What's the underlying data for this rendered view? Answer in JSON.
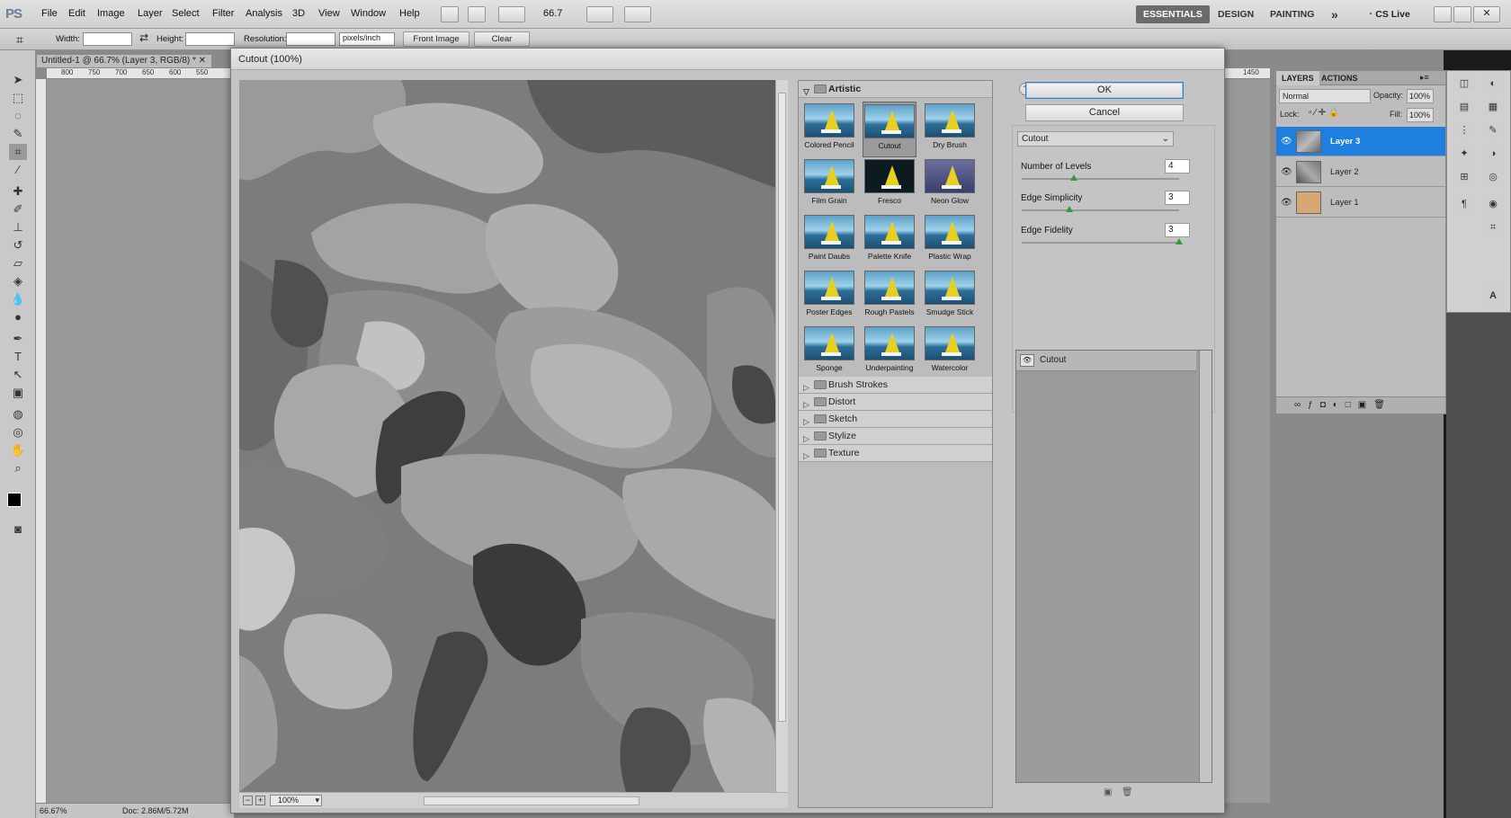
{
  "app": {
    "logo": "PS",
    "menus": [
      "File",
      "Edit",
      "Image",
      "Layer",
      "Select",
      "Filter",
      "Analysis",
      "3D",
      "View",
      "Window",
      "Help"
    ],
    "zoom": "66.7",
    "workspaces": [
      "ESSENTIALS",
      "DESIGN",
      "PAINTING"
    ],
    "more": "»",
    "cslive": "CS Live"
  },
  "options": {
    "width_label": "Width:",
    "height_label": "Height:",
    "resolution_label": "Resolution:",
    "res_unit": "pixels/inch",
    "front_image": "Front Image",
    "clear": "Clear"
  },
  "document": {
    "tab_title": "Untitled-1 @ 66.7% (Layer 3, RGB/8) *",
    "status_zoom": "66.67%",
    "status_doc": "Doc: 2.86M/5.72M",
    "ruler_ticks": [
      "800",
      "750",
      "700",
      "650",
      "600",
      "550"
    ],
    "ruler_right": "1450"
  },
  "dialog": {
    "title": "Cutout (100%)",
    "zoom": "100%",
    "ok": "OK",
    "cancel": "Cancel",
    "filter": "Cutout",
    "params": [
      {
        "label": "Number of Levels",
        "value": "4",
        "level": 0.33
      },
      {
        "label": "Edge Simplicity",
        "value": "3",
        "level": 0.3
      },
      {
        "label": "Edge Fidelity",
        "value": "3",
        "level": 1.0
      }
    ],
    "effect_layer": "Cutout"
  },
  "gallery": {
    "open_category": "Artistic",
    "thumbs": [
      "Colored Pencil",
      "Cutout",
      "Dry Brush",
      "Film Grain",
      "Fresco",
      "Neon Glow",
      "Paint Daubs",
      "Palette Knife",
      "Plastic Wrap",
      "Poster Edges",
      "Rough Pastels",
      "Smudge Stick",
      "Sponge",
      "Underpainting",
      "Watercolor"
    ],
    "selected": "Cutout",
    "categories": [
      "Brush Strokes",
      "Distort",
      "Sketch",
      "Stylize",
      "Texture"
    ]
  },
  "layers": {
    "tabs": [
      "LAYERS",
      "ACTIONS"
    ],
    "blend": "Normal",
    "opacity_label": "Opacity:",
    "opacity": "100%",
    "lock_label": "Lock:",
    "fill_label": "Fill:",
    "fill": "100%",
    "items": [
      {
        "name": "Layer 3",
        "active": true
      },
      {
        "name": "Layer 2",
        "active": false
      },
      {
        "name": "Layer 1",
        "active": false
      }
    ]
  }
}
